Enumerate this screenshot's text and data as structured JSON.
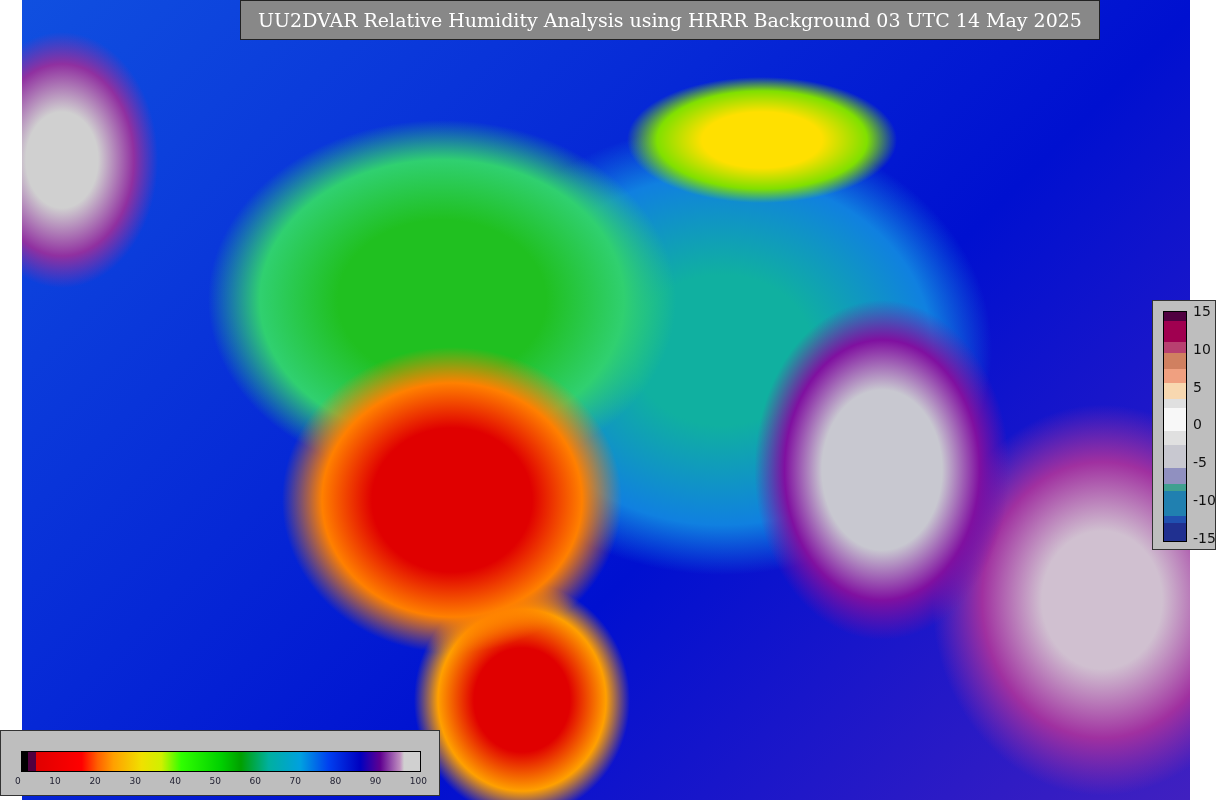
{
  "title": "UU2DVAR Relative Humidity Analysis using HRRR Background 03 UTC 14 May 2025",
  "humidity_colorbar": {
    "ticks": [
      "0",
      "10",
      "20",
      "30",
      "40",
      "50",
      "60",
      "70",
      "80",
      "90",
      "100"
    ]
  },
  "difference_colorbar": {
    "ticks": [
      "15",
      "10",
      "5",
      "0",
      "-5",
      "-10",
      "-15"
    ]
  }
}
